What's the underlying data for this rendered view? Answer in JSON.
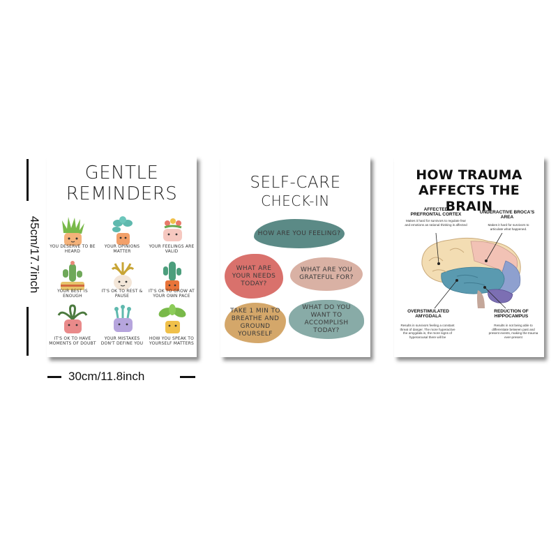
{
  "dimensions": {
    "height_label": "45cm/17.7inch",
    "width_label": "30cm/11.8inch"
  },
  "poster1": {
    "title_line1": "GENTLE",
    "title_line2": "REMINDERS",
    "items": [
      {
        "caption": "YOU DESERVE TO BE HEARD",
        "icon": "spiky-plant-icon"
      },
      {
        "caption": "YOUR OPINIONS MATTER",
        "icon": "leafy-plant-icon"
      },
      {
        "caption": "YOUR FEELINGS ARE VALID",
        "icon": "flower-cup-icon"
      },
      {
        "caption": "YOUR BEST IS ENOUGH",
        "icon": "cactus-icon"
      },
      {
        "caption": "IT'S OK TO REST & PAUSE",
        "icon": "yellow-plant-icon"
      },
      {
        "caption": "IT'S OK TO GROW AT YOUR OWN PACE",
        "icon": "tall-cactus-icon"
      },
      {
        "caption": "IT'S OK TO HAVE MOMENTS OF DOUBT",
        "icon": "fern-pot-icon"
      },
      {
        "caption": "YOUR MISTAKES DON'T DEFINE YOU",
        "icon": "purple-pot-icon"
      },
      {
        "caption": "HOW YOU SPEAK TO YOURSELF MATTERS",
        "icon": "large-leaf-plant-icon"
      }
    ]
  },
  "poster2": {
    "title_line1": "SELF-CARE",
    "title_line2": "CHECK-IN",
    "bubbles": [
      {
        "text": "HOW ARE YOU FEELING?",
        "color": "#5b8a86"
      },
      {
        "text": "WHAT ARE YOUR NEEDS TODAY?",
        "color": "#d9716c"
      },
      {
        "text": "WHAT ARE YOU GRATEFUL FOR?",
        "color": "#d9b1a4"
      },
      {
        "text": "TAKE 1 MIN TO BREATHE AND GROUND YOURSELF",
        "color": "#d4a76a"
      },
      {
        "text": "WHAT DO YOU WANT TO ACCOMPLISH TODAY?",
        "color": "#88aba7"
      }
    ]
  },
  "poster3": {
    "title_line1": "HOW TRAUMA",
    "title_line2": "AFFECTS THE BRAIN",
    "labels": {
      "pfc_title": "AFFECTED PREFRONTAL CORTEX",
      "pfc_desc": "Makes it hard for survivors to regulate fear and emotions as rational thinking is affected",
      "broca_title": "UNDERACTIVE BROCA'S AREA",
      "broca_desc": "Makes it hard for survivors to articulate what happened.",
      "amygdala_title": "OVERSTIMULATED AMYGDALA",
      "amygdala_desc": "Results in survivors feeling a constant threat of danger. The more hyperactive the amygdala is, the more signs of hyperarousal there will be",
      "hippo_title": "REDUCTION OF HIPPOCAMPUS",
      "hippo_desc": "Results in not being able to differentiate between past and present events, making the trauma ever-present"
    },
    "brain_colors": {
      "frontal": "#f3ddb3",
      "parietal": "#f2c2b5",
      "temporal": "#5a9ab0",
      "occipital": "#8ea0cf",
      "cerebellum": "#7c6fb3",
      "stem": "#c4a79a"
    }
  }
}
